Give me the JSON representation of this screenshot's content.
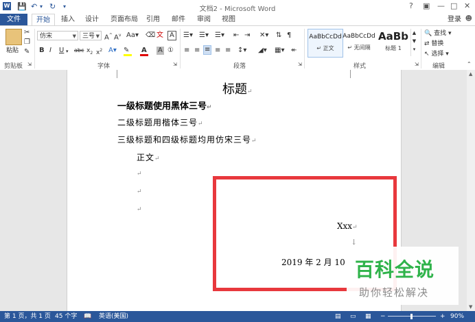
{
  "window": {
    "title": "文档2 - Microsoft Word",
    "help": "?",
    "controls": [
      "—",
      "□",
      "✕"
    ]
  },
  "tabs": {
    "file": "文件",
    "items": [
      "开始",
      "插入",
      "设计",
      "页面布局",
      "引用",
      "邮件",
      "审阅",
      "视图"
    ],
    "active": "开始",
    "login": "登录"
  },
  "ribbon": {
    "clipboard": {
      "paste": "粘贴",
      "label": "剪贴板"
    },
    "font": {
      "name": "仿宋",
      "size": "三号",
      "label": "字体"
    },
    "paragraph": {
      "label": "段落"
    },
    "styles": {
      "label": "样式",
      "items": [
        {
          "preview": "AaBbCcDd",
          "name": "↵ 正文"
        },
        {
          "preview": "AaBbCcDd",
          "name": "↵ 无间隔"
        },
        {
          "preview": "AaBb",
          "name": "标题 1"
        }
      ]
    },
    "editing": {
      "find": "查找",
      "replace": "替换",
      "select": "选择",
      "label": "编辑"
    }
  },
  "document": {
    "title": "标题",
    "lines": [
      "一级标题使用黑体三号",
      "二级标题用楷体三号",
      "三级标题和四级标题均用仿宋三号",
      "正文"
    ],
    "signature": "Xxx",
    "date": "2019 年 2 月 10"
  },
  "watermark": {
    "big": "百科全说",
    "small": "助你轻松解决"
  },
  "status": {
    "page": "第 1 页，共 1 页",
    "words": "45 个字",
    "lang": "英语(美国)",
    "zoom_level": "90%"
  }
}
